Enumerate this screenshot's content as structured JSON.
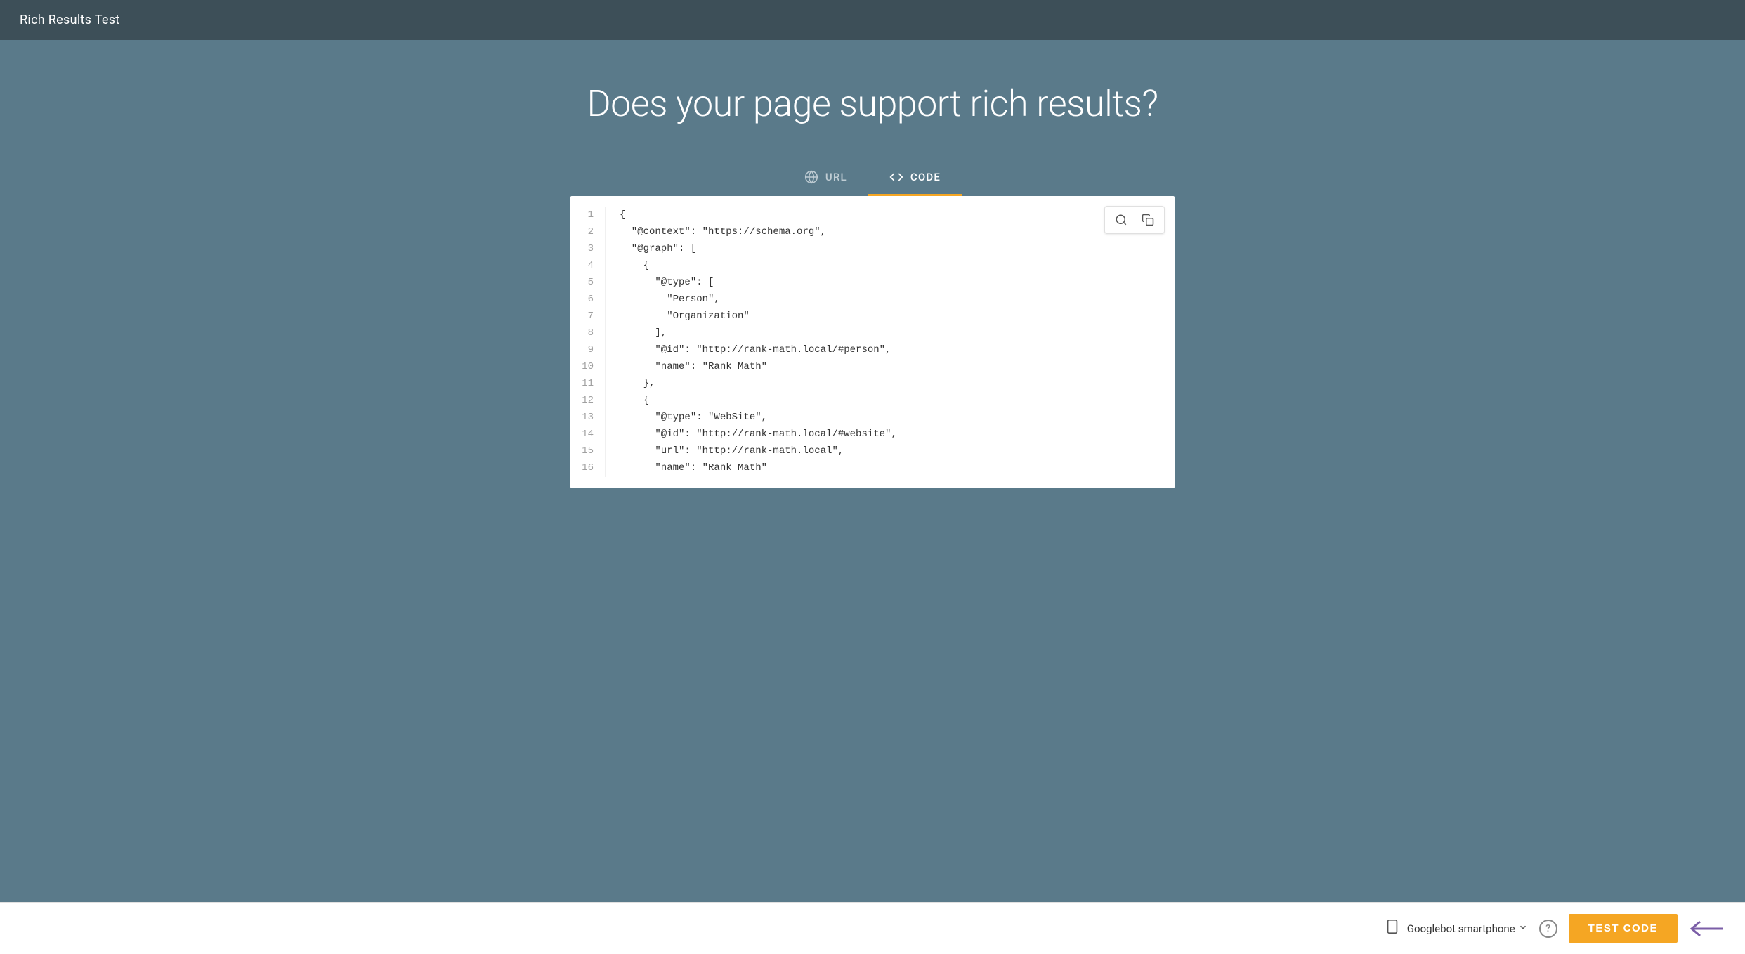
{
  "topbar": {
    "title": "Rich Results Test"
  },
  "hero": {
    "title": "Does your page support rich results?"
  },
  "tabs": [
    {
      "id": "url",
      "label": "URL",
      "icon": "🌐",
      "active": false
    },
    {
      "id": "code",
      "label": "CODE",
      "icon": "<>",
      "active": true
    }
  ],
  "code_editor": {
    "lines": [
      "{",
      "  \"@context\": \"https://schema.org\",",
      "  \"@graph\": [",
      "    {",
      "      \"@type\": [",
      "        \"Person\",",
      "        \"Organization\"",
      "      ],",
      "      \"@id\": \"http://rank-math.local/#person\",",
      "      \"name\": \"Rank Math\"",
      "    },",
      "    {",
      "      \"@type\": \"WebSite\",",
      "      \"@id\": \"http://rank-math.local/#website\",",
      "      \"url\": \"http://rank-math.local\",",
      "      \"name\": \"Rank Math\""
    ],
    "line_count": 16
  },
  "toolbar": {
    "search_label": "Search",
    "copy_label": "Copy"
  },
  "bottom_bar": {
    "device_icon": "📱",
    "device_label": "Googlebot smartphone",
    "help_label": "?",
    "test_button_label": "TEST CODE"
  }
}
